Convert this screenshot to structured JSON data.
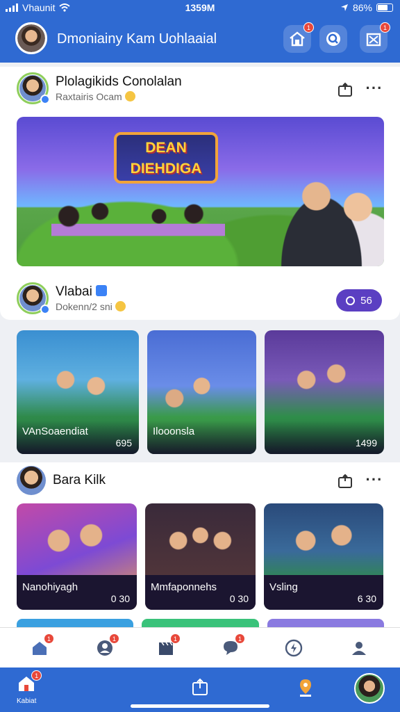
{
  "status_bar": {
    "carrier": "Vhaunit",
    "time": "1359M",
    "battery": "86%"
  },
  "header": {
    "title": "Dmoniainy Kam Uohlaaial",
    "badges": {
      "home": "1",
      "share": "1"
    }
  },
  "post1": {
    "author": "Plolagikids Conolalan",
    "subtitle": "Raxtairis Ocam",
    "banner_title": "DEAN DIEHDIGA"
  },
  "post1_sub": {
    "author": "Vlabai",
    "subtitle": "Dokenn/2 sni",
    "pill_value": "56"
  },
  "tiles_row1": [
    {
      "label": "VAnSoaendiat",
      "count": "695"
    },
    {
      "label": "Ilooonsla",
      "count": ""
    },
    {
      "label": "",
      "count": "1499"
    }
  ],
  "post2": {
    "author": "Bara  Kilk"
  },
  "tiles_row2": [
    {
      "label": "Nanohiyagh",
      "count": "0 30"
    },
    {
      "label": "Mmfaponnehs",
      "count": "0 30"
    },
    {
      "label": "Vsling",
      "count": "6 30"
    }
  ],
  "bottom_nav": {
    "badges": [
      "1",
      "1",
      "1",
      "1"
    ]
  },
  "tabbar": {
    "home_label": "Kabiat",
    "home_badge": "1"
  },
  "colors": {
    "brand_blue": "#2f6ad2",
    "pill_purple": "#5b3fc2",
    "badge_red": "#e8483a"
  }
}
